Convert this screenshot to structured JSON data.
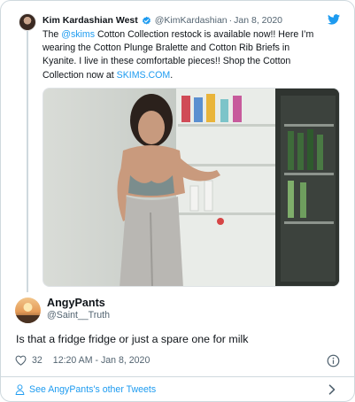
{
  "quoted_tweet": {
    "author_name": "Kim Kardashian West",
    "author_handle": "@KimKardashian",
    "separator": "·",
    "date": "Jan 8, 2020",
    "text_part_1": "The ",
    "mention": "@skims",
    "text_part_2": " Cotton Collection restock is available now!! Here I’m wearing the Cotton Plunge Bralette and Cotton Rib Briefs in Kyanite. I live in these comfortable pieces!! Shop the Cotton Collection now at ",
    "link": "SKIMS.COM",
    "text_part_3": "."
  },
  "reply": {
    "author_name": "AngyPants",
    "author_handle": "@Saint__Truth",
    "text": "Is that a fridge fridge or just a spare one for milk",
    "likes": "32",
    "timestamp": "12:20 AM - Jan 8, 2020"
  },
  "footer": {
    "label": "See AngyPants's other Tweets"
  },
  "colors": {
    "accent": "#1d9bf0",
    "secondary_text": "#536471",
    "border": "#cfd9de"
  },
  "icons": {
    "verified": "verified-badge-icon",
    "bird": "twitter-bird-icon",
    "heart": "heart-icon",
    "info": "info-icon",
    "person": "person-icon",
    "chevron": "chevron-right-icon"
  }
}
